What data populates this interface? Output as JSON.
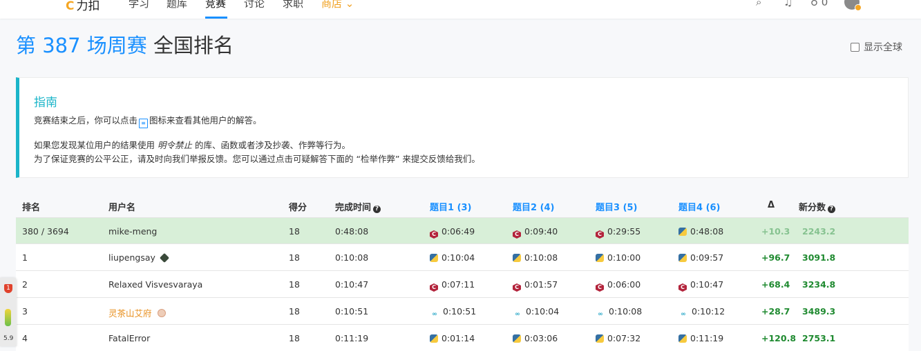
{
  "nav": {
    "logo": "力扣",
    "items": [
      "学习",
      "题库",
      "竞赛",
      "讨论",
      "求职"
    ],
    "store": "商店",
    "points": "0"
  },
  "header": {
    "title_highlight": "第 387 场周赛",
    "title_rest": "全国排名",
    "global_toggle": "显示全球"
  },
  "guide": {
    "title": "指南",
    "line1_before": "竞赛结束之后，你可以点击",
    "line1_after": "图标来查看其他用户的解答。",
    "line2_before": "如果您发现某位用户的结果使用",
    "line2_em": "明令禁止",
    "line2_after": "的库、函数或者涉及抄袭、作弊等行为。",
    "line3": "为了保证竞赛的公平公正，请及时向我们举报反馈。您可以通过点击可疑解答下面的 “检举作弊” 来提交反馈给我们。"
  },
  "table": {
    "headers": {
      "rank": "排名",
      "user": "用户名",
      "score": "得分",
      "time": "完成时间",
      "q1": "题目1 (3)",
      "q2": "题目2 (4)",
      "q3": "题目3 (5)",
      "q4": "题目4 (6)",
      "delta": "Δ",
      "rating": "新分数"
    },
    "rows": [
      {
        "rank": "380 / 3694",
        "user": "mike-meng",
        "score": "18",
        "time": "0:48:08",
        "q1": "0:06:49",
        "q2": "0:09:40",
        "q3": "0:29:55",
        "q4": "0:48:08",
        "delta": "+10.3",
        "rating": "2243.2"
      },
      {
        "rank": "1",
        "user": "liupengsay",
        "score": "18",
        "time": "0:10:08",
        "q1": "0:10:04",
        "q2": "0:10:08",
        "q3": "0:10:00",
        "q4": "0:09:57",
        "delta": "+96.7",
        "rating": "3091.8"
      },
      {
        "rank": "2",
        "user": "Relaxed Visvesvaraya",
        "score": "18",
        "time": "0:10:47",
        "q1": "0:07:11",
        "q2": "0:01:57",
        "q3": "0:06:00",
        "q4": "0:10:47",
        "delta": "+68.4",
        "rating": "3234.8"
      },
      {
        "rank": "3",
        "user": "灵茶山艾府",
        "score": "18",
        "time": "0:10:51",
        "q1": "0:10:51",
        "q2": "0:10:04",
        "q3": "0:10:08",
        "q4": "0:10:12",
        "delta": "+28.7",
        "rating": "3489.3"
      },
      {
        "rank": "4",
        "user": "FatalError",
        "score": "18",
        "time": "0:11:19",
        "q1": "0:01:14",
        "q2": "0:03:06",
        "q3": "0:07:32",
        "q4": "0:11:19",
        "delta": "+120.8",
        "rating": "2753.1"
      }
    ]
  },
  "widget": {
    "badge": "1",
    "version": "5.9"
  },
  "colors": {
    "accent": "#1a90ff",
    "guide": "#1bb5c9",
    "positive": "#1f8a30",
    "highlight_row": "#d8efd8"
  }
}
